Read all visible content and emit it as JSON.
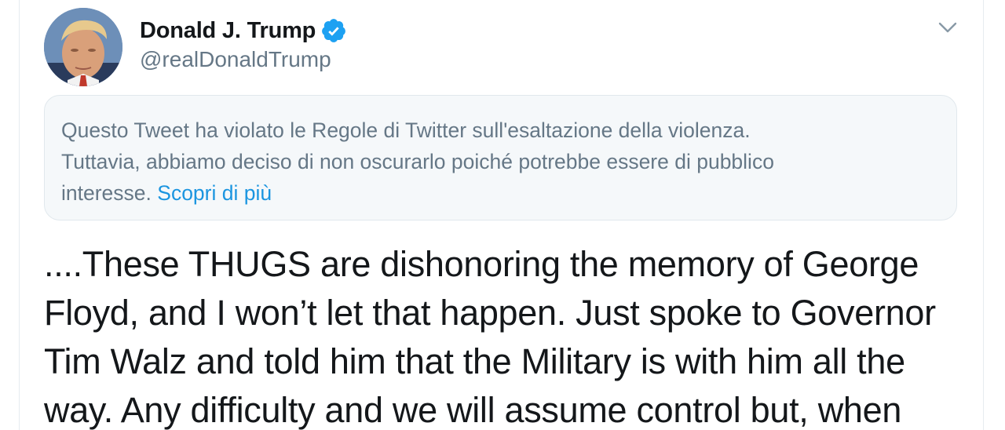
{
  "author": {
    "display_name": "Donald J. Trump",
    "handle": "@realDonaldTrump",
    "verified": true
  },
  "icons": {
    "verified": "verified-badge-icon",
    "more": "chevron-down-icon",
    "avatar": "profile-photo"
  },
  "notice": {
    "text": "Questo Tweet ha violato le Regole di Twitter sull'esaltazione della violenza. Tuttavia, abbiamo deciso di non oscurarlo poiché potrebbe essere di pubblico interesse.",
    "lines": [
      "Questo Tweet ha violato le Regole di Twitter sull'esaltazione della violenza.",
      "Tuttavia, abbiamo deciso di non oscurarlo poiché potrebbe essere di pubblico",
      "interesse."
    ],
    "link_label": "Scopri di più"
  },
  "tweet": {
    "lines": [
      "....These THUGS are dishonoring the memory of George",
      "Floyd, and I won’t let that happen. Just spoke to Governor",
      "Tim Walz and told him that the Military is with him all the",
      "way. Any difficulty and we will assume control but, when"
    ]
  },
  "colors": {
    "verified_blue": "#1da1f2",
    "link_blue": "#1b95e0",
    "notice_bg": "#f5f8fa",
    "secondary_text": "#657786",
    "primary_text": "#14171a"
  }
}
